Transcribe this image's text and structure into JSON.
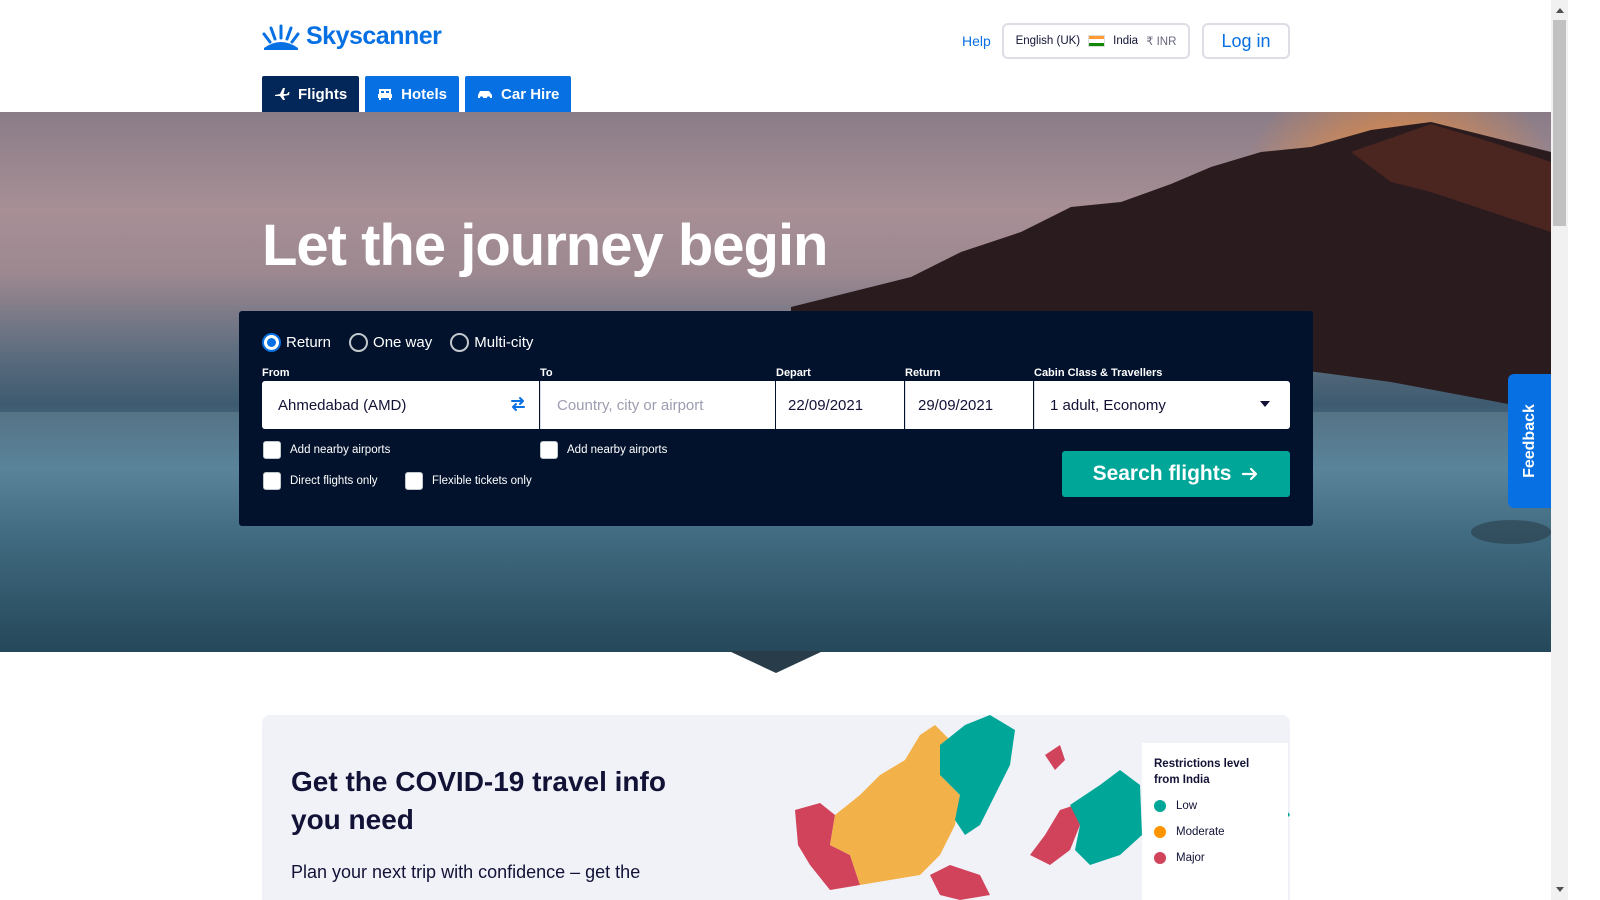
{
  "brand": {
    "name": "Skyscanner",
    "color": "#0770e3"
  },
  "header": {
    "help_label": "Help",
    "locale": {
      "language": "English (UK)",
      "country": "India",
      "currency": "₹ INR"
    },
    "login_label": "Log in"
  },
  "tabs": [
    {
      "label": "Flights",
      "icon": "plane-icon",
      "active": true
    },
    {
      "label": "Hotels",
      "icon": "bed-icon",
      "active": false
    },
    {
      "label": "Car Hire",
      "icon": "car-icon",
      "active": false
    }
  ],
  "hero": {
    "title": "Let the journey begin"
  },
  "search": {
    "trip_types": [
      {
        "label": "Return",
        "selected": true
      },
      {
        "label": "One way",
        "selected": false
      },
      {
        "label": "Multi-city",
        "selected": false
      }
    ],
    "from": {
      "label": "From",
      "value": "Ahmedabad (AMD)"
    },
    "to": {
      "label": "To",
      "placeholder": "Country, city or airport"
    },
    "depart": {
      "label": "Depart",
      "value": "22/09/2021"
    },
    "return": {
      "label": "Return",
      "value": "29/09/2021"
    },
    "cabin": {
      "label": "Cabin Class & Travellers",
      "value": "1 adult, Economy"
    },
    "options": {
      "nearby_from": "Add nearby airports",
      "nearby_to": "Add nearby airports",
      "direct": "Direct flights only",
      "flexible": "Flexible tickets only"
    },
    "submit_label": "Search flights",
    "submit_color": "#00a698"
  },
  "feedback_label": "Feedback",
  "covid": {
    "title": "Get the COVID-19 travel info you need",
    "subtitle": "Plan your next trip with confidence – get the",
    "legend": {
      "title": "Restrictions level from India",
      "items": [
        {
          "label": "Low",
          "color": "#00a698"
        },
        {
          "label": "Moderate",
          "color": "#ff9400"
        },
        {
          "label": "Major",
          "color": "#d1435b"
        }
      ]
    }
  }
}
